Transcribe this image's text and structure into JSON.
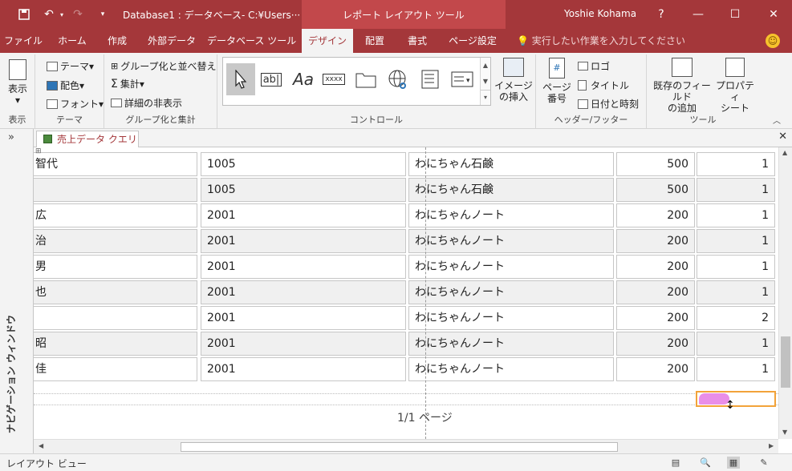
{
  "title_bar": {
    "doc_title": "Database1 : データベース- C:¥Users···",
    "context_title": "レポート レイアウト ツール",
    "user": "Yoshie Kohama",
    "help": "?",
    "minimize": "—",
    "maximize": "☐",
    "close": "✕"
  },
  "tabs": [
    "ファイル",
    "ホーム",
    "作成",
    "外部データ",
    "データベース ツール",
    "デザイン",
    "配置",
    "書式",
    "ページ設定"
  ],
  "active_tab": "デザイン",
  "tell_me": "実行したい作業を入力してください",
  "ribbon": {
    "view": {
      "label": "表示",
      "group": "表示"
    },
    "theme": {
      "themes": "テーマ",
      "colors": "配色",
      "fonts": "フォント",
      "group": "テーマ"
    },
    "grouping": {
      "group_sort": "グループ化と並べ替え",
      "totals": "集計",
      "hide_details": "詳細の非表示",
      "group": "グループ化と集計"
    },
    "controls": {
      "group": "コントロール",
      "insert_image": "イメージ\nの挿入"
    },
    "header_footer": {
      "page_numbers": "ページ\n番号",
      "logo": "ロゴ",
      "title": "タイトル",
      "date_time": "日付と時刻",
      "group": "ヘッダー/フッター"
    },
    "tools": {
      "add_fields": "既存のフィールド\nの追加",
      "property_sheet": "プロパティ\nシート",
      "group": "ツール"
    }
  },
  "doc_tab": "売上データ クエリ",
  "nav_pane": "ナビゲーション ウィンドウ",
  "rows": [
    {
      "name": "智代",
      "code": "1005",
      "product": "わにちゃん石鹸",
      "price": "500",
      "qty": "1"
    },
    {
      "name": "",
      "code": "1005",
      "product": "わにちゃん石鹸",
      "price": "500",
      "qty": "1"
    },
    {
      "name": "広",
      "code": "2001",
      "product": "わにちゃんノート",
      "price": "200",
      "qty": "1"
    },
    {
      "name": "治",
      "code": "2001",
      "product": "わにちゃんノート",
      "price": "200",
      "qty": "1"
    },
    {
      "name": "男",
      "code": "2001",
      "product": "わにちゃんノート",
      "price": "200",
      "qty": "1"
    },
    {
      "name": "也",
      "code": "2001",
      "product": "わにちゃんノート",
      "price": "200",
      "qty": "1"
    },
    {
      "name": "",
      "code": "2001",
      "product": "わにちゃんノート",
      "price": "200",
      "qty": "2"
    },
    {
      "name": "昭",
      "code": "2001",
      "product": "わにちゃんノート",
      "price": "200",
      "qty": "1"
    },
    {
      "name": "佳",
      "code": "2001",
      "product": "わにちゃんノート",
      "price": "200",
      "qty": "1"
    }
  ],
  "page_number": "1/1 ページ",
  "status": "レイアウト ビュー",
  "accent": "#a4373a"
}
